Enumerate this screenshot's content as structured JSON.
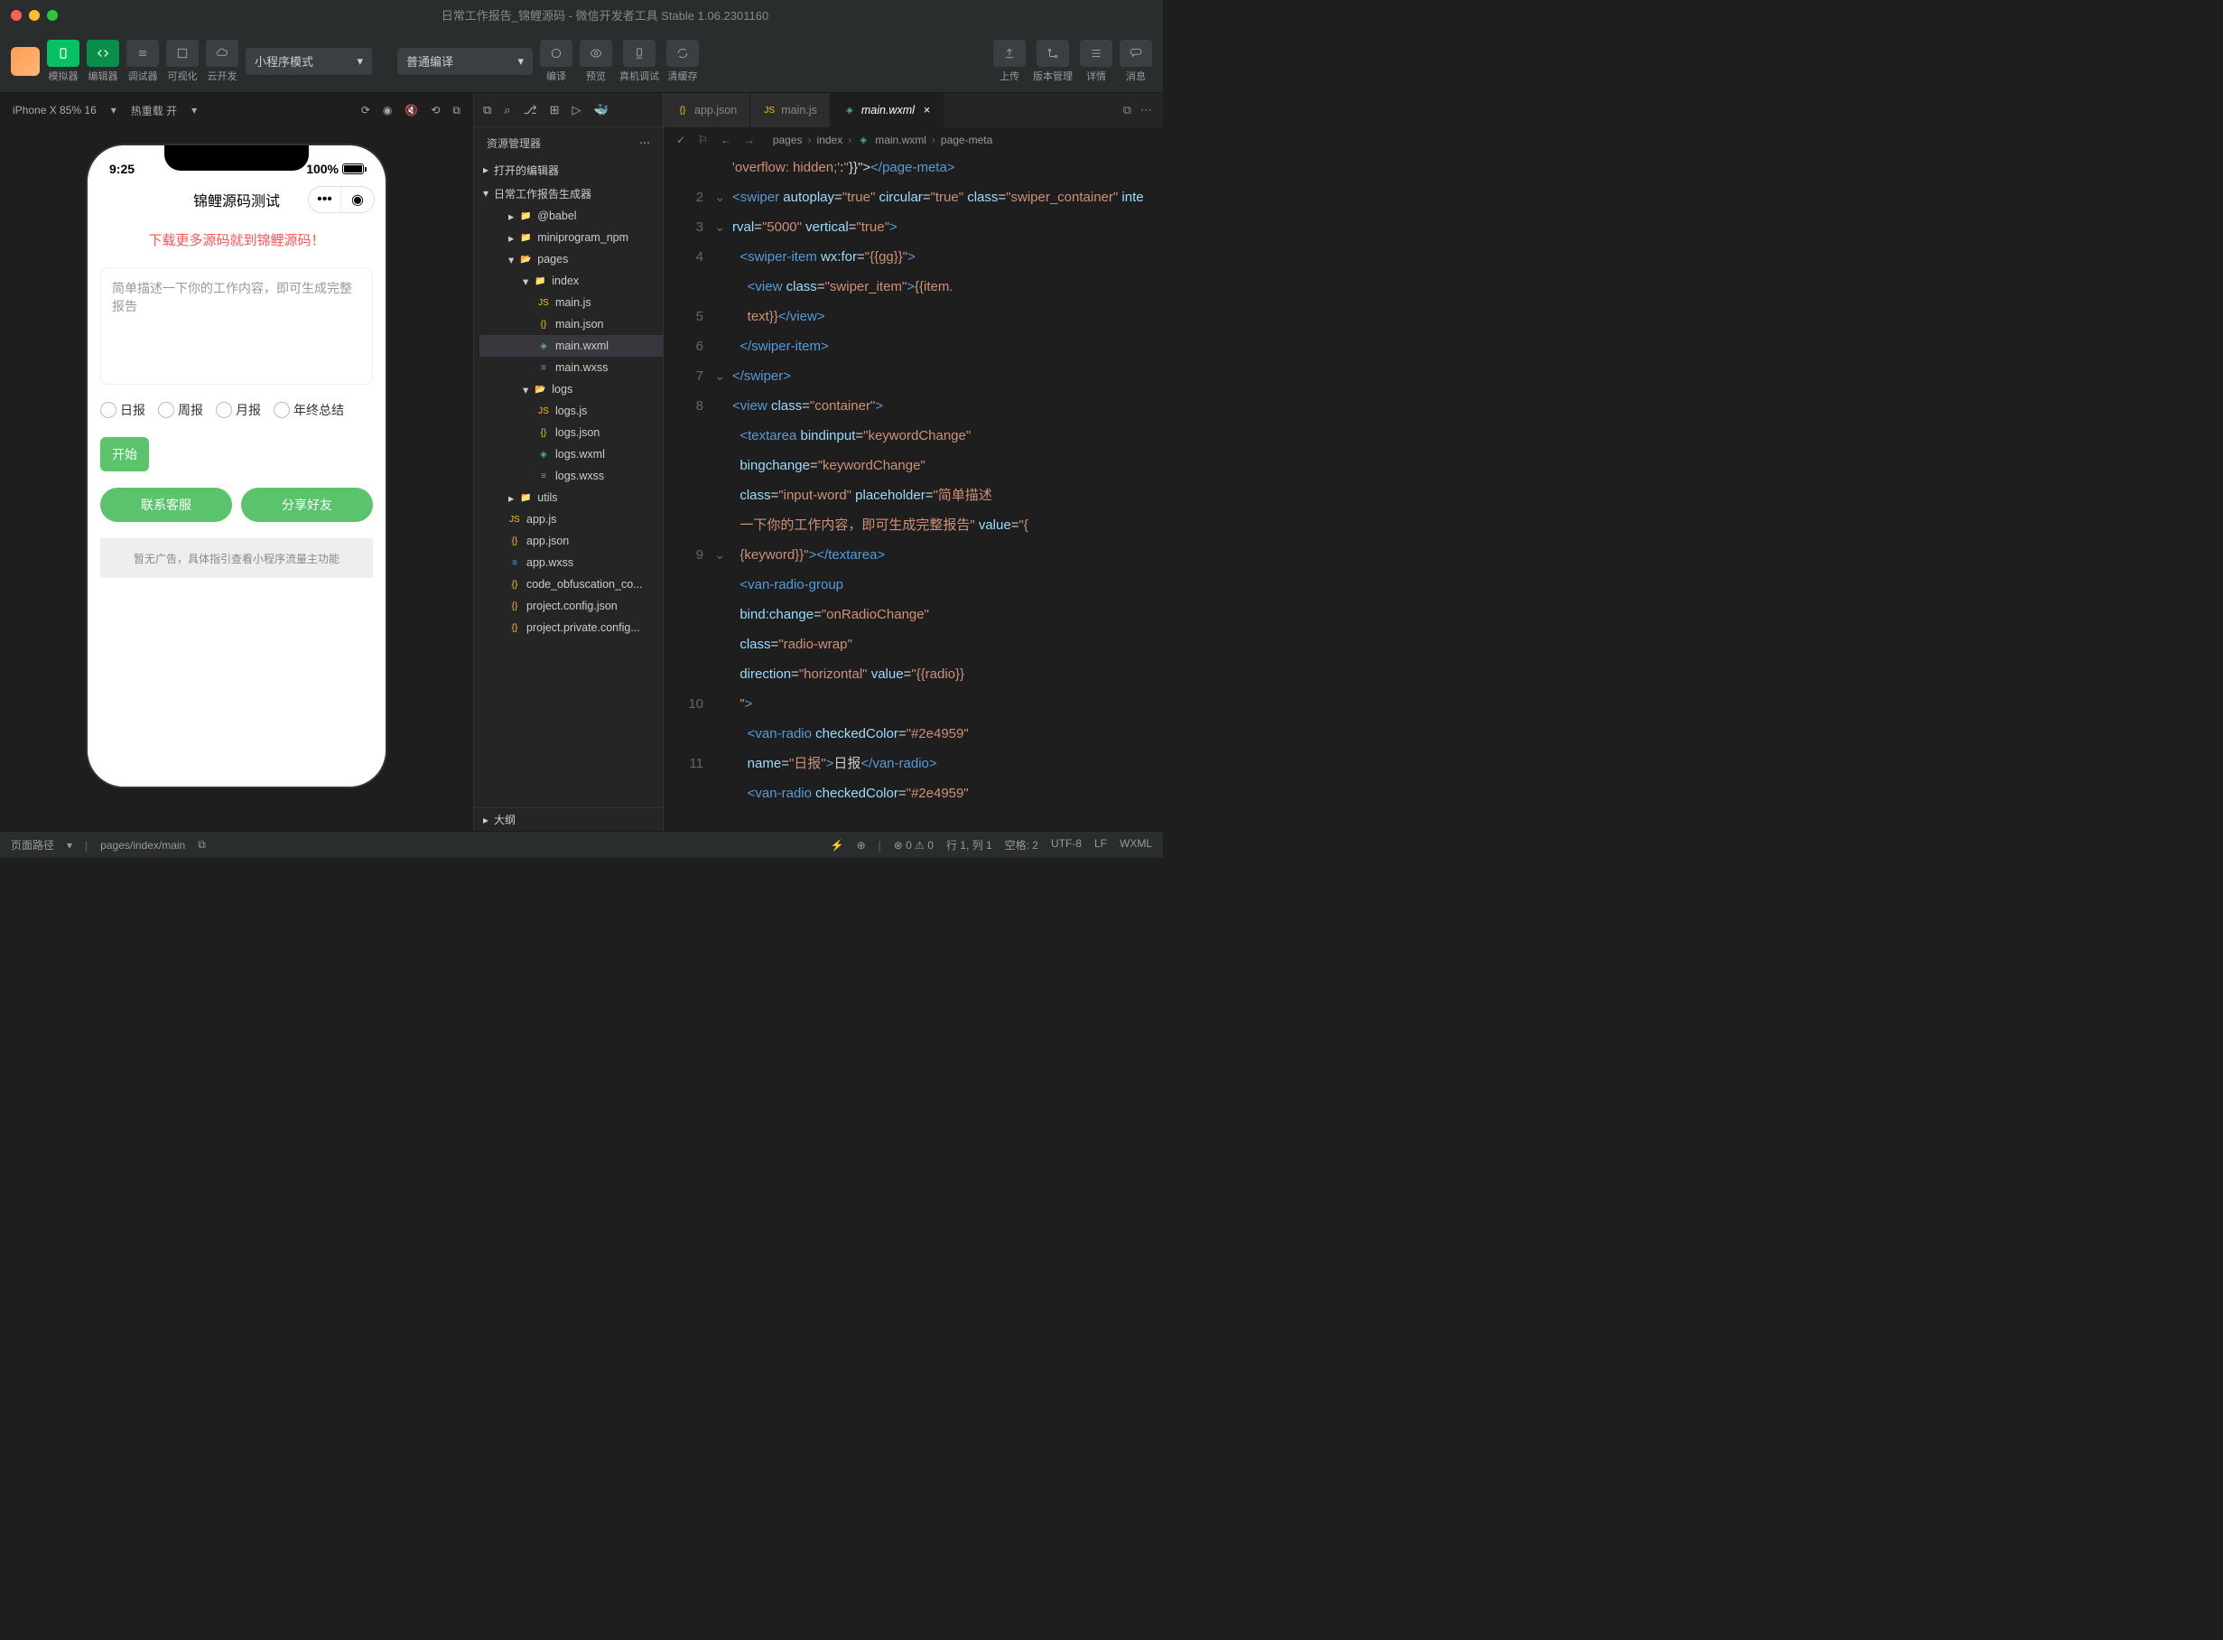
{
  "titlebar": {
    "title": "日常工作报告_锦鲤源码 - 微信开发者工具 Stable 1.06.2301160"
  },
  "toolbar": {
    "simulate": "模拟器",
    "editor": "编辑器",
    "debugger": "调试器",
    "visualize": "可视化",
    "cloud": "云开发",
    "mode": "小程序模式",
    "compile_mode": "普通编译",
    "compile": "编译",
    "preview": "预览",
    "real_debug": "真机调试",
    "clear_cache": "清缓存",
    "upload": "上传",
    "version": "版本管理",
    "details": "详情",
    "messages": "消息"
  },
  "simulator": {
    "device": "iPhone X 85% 16",
    "hot_reload": "热重载 开",
    "time": "9:25",
    "battery": "100%",
    "nav_title": "锦鲤源码测试",
    "swiper_text": "下载更多源码就到锦鲤源码！",
    "textarea_placeholder": "简单描述一下你的工作内容，即可生成完整报告",
    "radio_daily": "日报",
    "radio_weekly": "周报",
    "radio_monthly": "月报",
    "radio_yearly": "年终总结",
    "start_btn": "开始",
    "contact_btn": "联系客服",
    "share_btn": "分享好友",
    "ad_text": "暂无广告，具体指引查看小程序流量主功能"
  },
  "explorer": {
    "title": "资源管理器",
    "opened_editors": "打开的编辑器",
    "project_name": "日常工作报告生成器",
    "outline": "大纲",
    "tree": {
      "babel": "@babel",
      "miniprogram_npm": "miniprogram_npm",
      "pages": "pages",
      "index": "index",
      "main_js": "main.js",
      "main_json": "main.json",
      "main_wxml": "main.wxml",
      "main_wxss": "main.wxss",
      "logs": "logs",
      "logs_js": "logs.js",
      "logs_json": "logs.json",
      "logs_wxml": "logs.wxml",
      "logs_wxss": "logs.wxss",
      "utils": "utils",
      "app_js": "app.js",
      "app_json": "app.json",
      "app_wxss": "app.wxss",
      "code_obfus": "code_obfuscation_co...",
      "project_config": "project.config.json",
      "project_private": "project.private.config..."
    }
  },
  "editor": {
    "tabs": {
      "app_json": "app.json",
      "main_js": "main.js",
      "main_wxml": "main.wxml"
    },
    "breadcrumb": {
      "pages": "pages",
      "index": "index",
      "main_wxml": "main.wxml",
      "page_meta": "page-meta"
    }
  },
  "statusbar": {
    "page_path_label": "页面路径",
    "page_path": "pages/index/main",
    "errors": "0",
    "warnings": "0",
    "cursor": "行 1, 列 1",
    "spaces": "空格: 2",
    "encoding": "UTF-8",
    "eol": "LF",
    "lang": "WXML"
  }
}
